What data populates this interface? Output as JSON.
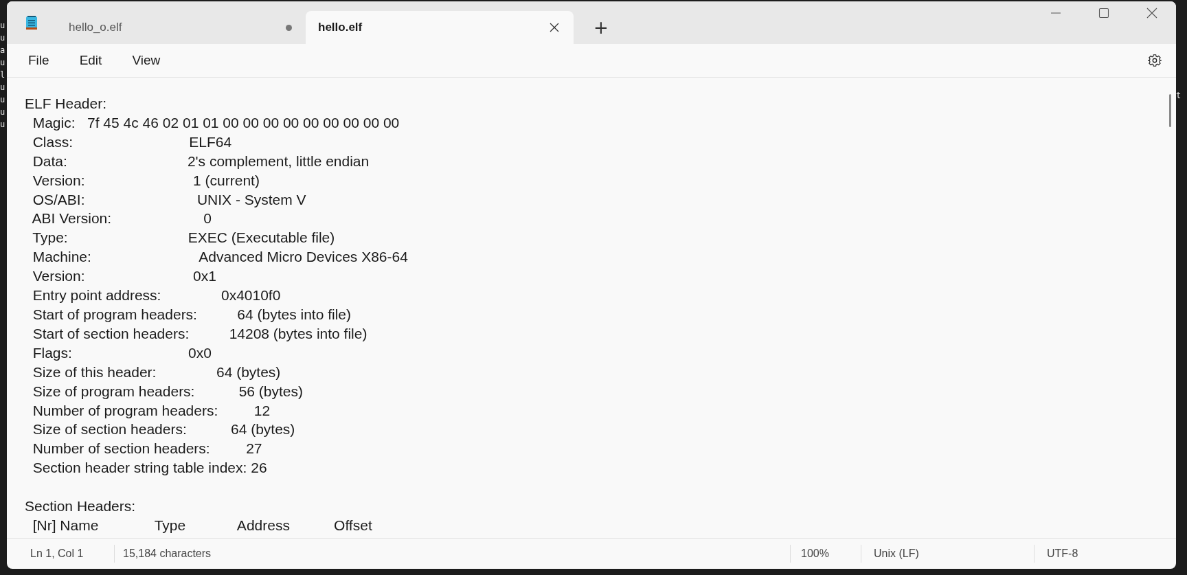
{
  "background_terminal": {
    "left_chars": [
      "u",
      "u",
      "a",
      "u",
      "l",
      "u",
      "u",
      "u",
      "u"
    ],
    "right_chars": [
      "t"
    ]
  },
  "tabs": [
    {
      "title": "hello_o.elf",
      "selected": false,
      "unsaved": true
    },
    {
      "title": "hello.elf",
      "selected": true,
      "unsaved": false
    }
  ],
  "new_tab": "+",
  "menu": [
    "File",
    "Edit",
    "View"
  ],
  "document": [
    {
      "lines": [
        "ELF Header:",
        "  Magic:   7f 45 4c 46 02 01 01 00 00 00 00 00 00 00 00 00",
        "  Class:                             ELF64",
        "  Data:                              2's complement, little endian",
        "  Version:                           1 (current)",
        "  OS/ABI:                            UNIX - System V",
        "  ABI Version:                       0",
        "  Type:                              EXEC (Executable file)",
        "  Machine:                           Advanced Micro Devices X86-64",
        "  Version:                           0x1",
        "  Entry point address:               0x4010f0",
        "  Start of program headers:          64 (bytes into file)",
        "  Start of section headers:          14208 (bytes into file)",
        "  Flags:                             0x0",
        "  Size of this header:               64 (bytes)",
        "  Size of program headers:           56 (bytes)",
        "  Number of program headers:         12",
        "  Size of section headers:           64 (bytes)",
        "  Number of section headers:         27",
        "  Section header string table index: 26"
      ]
    },
    {
      "lines": [
        "Section Headers:",
        "  [Nr] Name              Type             Address           Offset"
      ]
    }
  ],
  "status_bar": {
    "position": "Ln 1, Col 1",
    "characters": "15,184 characters",
    "zoom": "100%",
    "line_ending": "Unix (LF)",
    "encoding": "UTF-8"
  }
}
